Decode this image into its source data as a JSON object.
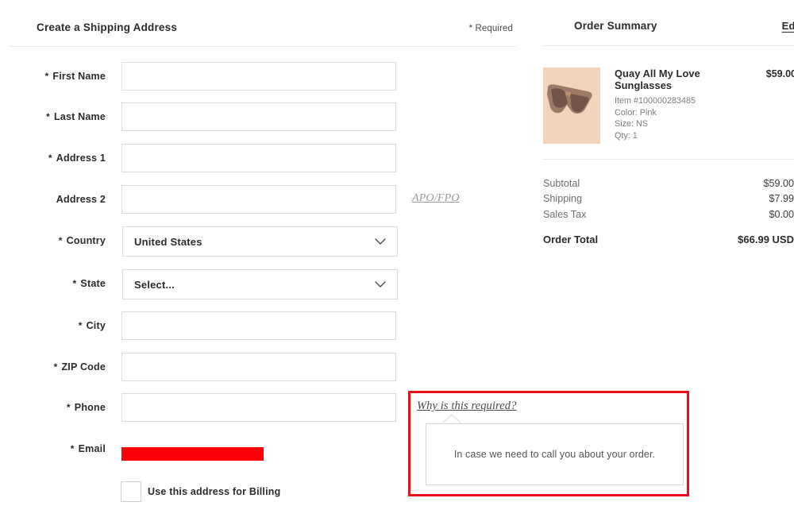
{
  "shipping": {
    "section_title": "Create a Shipping Address",
    "required_note": "* Required",
    "asterisk": "*",
    "apo_link": "APO/FPO",
    "fields": [
      {
        "label": "First Name",
        "required": true,
        "type": "text",
        "value": ""
      },
      {
        "label": "Last Name",
        "required": true,
        "type": "text",
        "value": ""
      },
      {
        "label": "Address 1",
        "required": true,
        "type": "text",
        "value": ""
      },
      {
        "label": "Address 2",
        "required": false,
        "type": "text",
        "value": ""
      },
      {
        "label": "Country",
        "required": true,
        "type": "select",
        "value": "United States"
      },
      {
        "label": "State",
        "required": true,
        "type": "select",
        "value": "Select..."
      },
      {
        "label": "City",
        "required": true,
        "type": "text",
        "value": ""
      },
      {
        "label": "ZIP Code",
        "required": true,
        "type": "text",
        "value": ""
      },
      {
        "label": "Phone",
        "required": true,
        "type": "text",
        "value": ""
      },
      {
        "label": "Email",
        "required": true,
        "type": "redacted",
        "value": ""
      }
    ],
    "billing_checkbox": {
      "label": "Use this address for Billing",
      "checked": false
    }
  },
  "tooltip": {
    "link_text": "Why is this required?",
    "body_text": "In case we need to call you about your order.",
    "highlight_color": "#e8111b"
  },
  "summary": {
    "title": "Order Summary",
    "edit_bag": "Edit Bag",
    "item": {
      "name": "Quay All My Love Sunglasses",
      "item_number": "Item #100000283485",
      "color": "Color: Pink",
      "size": "Size: NS",
      "qty": "Qty: 1",
      "price": "$59.00",
      "image_bg": "#f3d3b9"
    },
    "totals": [
      {
        "label": "Subtotal",
        "value": "$59.00"
      },
      {
        "label": "Shipping",
        "value": "$7.99"
      },
      {
        "label": "Sales Tax",
        "value": "$0.00"
      }
    ],
    "order_total": {
      "label": "Order Total",
      "value": "$66.99 USD"
    }
  }
}
